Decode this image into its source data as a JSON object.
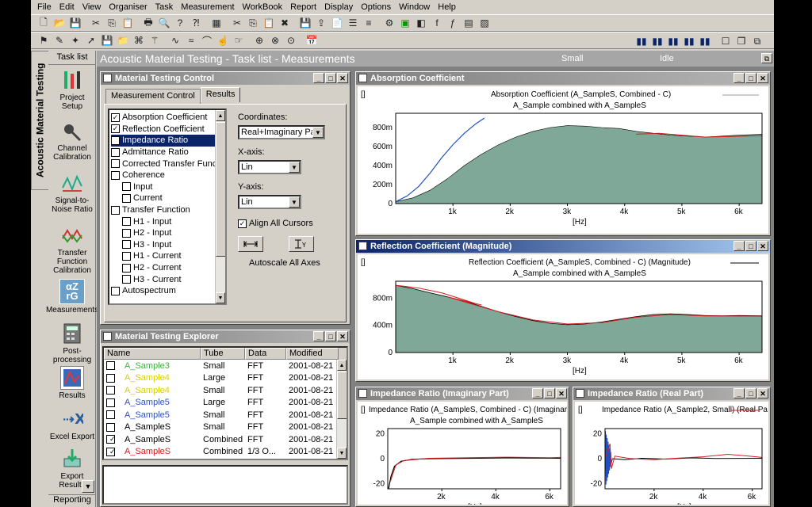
{
  "menu": [
    "File",
    "Edit",
    "View",
    "Organiser",
    "Task",
    "Measurement",
    "WorkBook",
    "Report",
    "Display",
    "Options",
    "Window",
    "Help"
  ],
  "sidebar": {
    "vertical_tab": "Acoustic Material Testing",
    "title": "Task list",
    "items": [
      {
        "label": "Project Setup"
      },
      {
        "label": "Channel Calibration"
      },
      {
        "label": "Signal-to-Noise Ratio"
      },
      {
        "label": "Transfer Function Calibration"
      },
      {
        "label": "Measurements"
      },
      {
        "label": "Post-processing"
      },
      {
        "label": "Results"
      },
      {
        "label": "Excel Export"
      },
      {
        "label": "Export Results"
      }
    ],
    "bottom": "Reporting"
  },
  "main": {
    "title": "Acoustic Material Testing - Task list - Measurements",
    "status1": "Small",
    "status2": "Idle"
  },
  "control": {
    "title": "Material Testing Control",
    "tabs": [
      "Measurement Control",
      "Results"
    ],
    "items": [
      {
        "label": "Absorption Coefficient",
        "checked": true,
        "indent": 0
      },
      {
        "label": "Reflection Coefficient",
        "checked": true,
        "indent": 0
      },
      {
        "label": "Impedance Ratio",
        "checked": true,
        "indent": 0
      },
      {
        "label": "Admittance Ratio",
        "checked": false,
        "indent": 0
      },
      {
        "label": "Corrected Transfer Function",
        "checked": false,
        "indent": 0
      },
      {
        "label": "Coherence",
        "checked": false,
        "indent": 0
      },
      {
        "label": "Input",
        "checked": false,
        "indent": 1
      },
      {
        "label": "Current",
        "checked": false,
        "indent": 1
      },
      {
        "label": "Transfer Function",
        "checked": false,
        "indent": 0
      },
      {
        "label": "H1 - Input",
        "checked": false,
        "indent": 1
      },
      {
        "label": "H2 - Input",
        "checked": false,
        "indent": 1
      },
      {
        "label": "H3 - Input",
        "checked": false,
        "indent": 1
      },
      {
        "label": "H1 - Current",
        "checked": false,
        "indent": 1
      },
      {
        "label": "H2 - Current",
        "checked": false,
        "indent": 1
      },
      {
        "label": "H3 - Current",
        "checked": false,
        "indent": 1
      },
      {
        "label": "Autospectrum",
        "checked": false,
        "indent": 0
      }
    ],
    "coordinates_label": "Coordinates:",
    "coordinates_value": "Real+Imaginary Part",
    "xaxis_label": "X-axis:",
    "xaxis_value": "Lin",
    "yaxis_label": "Y-axis:",
    "yaxis_value": "Lin",
    "align_cursors": "Align All Cursors",
    "autoscale": "Autoscale All Axes"
  },
  "explorer": {
    "title": "Material Testing Explorer",
    "columns": [
      "Name",
      "Tube",
      "Data",
      "Modified"
    ],
    "rows": [
      {
        "name": "A_Sample3",
        "tube": "Small",
        "data": "FFT",
        "modified": "2001-08-21 ...",
        "checked": false,
        "color": "#40b040"
      },
      {
        "name": "A_Sample4",
        "tube": "Large",
        "data": "FFT",
        "modified": "2001-08-21 ...",
        "checked": false,
        "color": "#d8d000"
      },
      {
        "name": "A_Sample4",
        "tube": "Small",
        "data": "FFT",
        "modified": "2001-08-21 ...",
        "checked": false,
        "color": "#d8d000"
      },
      {
        "name": "A_Sample5",
        "tube": "Large",
        "data": "FFT",
        "modified": "2001-08-21 ...",
        "checked": false,
        "color": "#3050c0"
      },
      {
        "name": "A_Sample5",
        "tube": "Small",
        "data": "FFT",
        "modified": "2001-08-21 ...",
        "checked": false,
        "color": "#3050c0"
      },
      {
        "name": "A_SampleS",
        "tube": "Small",
        "data": "FFT",
        "modified": "2001-08-21 ...",
        "checked": false,
        "color": "#000000"
      },
      {
        "name": "A_SampleS",
        "tube": "Combined",
        "data": "FFT",
        "modified": "2001-08-21 ...",
        "checked": true,
        "color": "#000000"
      },
      {
        "name": "A_SampleS",
        "tube": "Combined",
        "data": "1/3 O...",
        "modified": "2001-08-21 ...",
        "checked": true,
        "color": "#d02020"
      }
    ]
  },
  "absorption": {
    "title": "Absorption Coefficient",
    "bracket": "[]",
    "header": "Absorption Coefficient (A_SampleS, Combined - C)",
    "subheader": "A_Sample combined with A_SampleS",
    "xunit": "[Hz]",
    "xticks": [
      "1k",
      "2k",
      "3k",
      "4k",
      "5k",
      "6k"
    ],
    "yticks": [
      "0",
      "200m",
      "400m",
      "600m",
      "800m"
    ]
  },
  "reflection": {
    "title": "Reflection Coefficient (Magnitude)",
    "bracket": "[]",
    "header": "Reflection Coefficient (A_SampleS, Combined - C) (Magnitude)",
    "subheader": "A_Sample combined with A_SampleS",
    "xunit": "[Hz]",
    "xticks": [
      "1k",
      "2k",
      "3k",
      "4k",
      "5k",
      "6k"
    ],
    "yticks": [
      "0",
      "400m",
      "800m"
    ]
  },
  "imp_imag": {
    "title": "Impedance Ratio (Imaginary Part)",
    "bracket": "[]",
    "header": "Impedance Ratio (A_SampleS, Combined - C) (Imaginary",
    "subheader": "A_Sample combined with A_SampleS",
    "xunit": "[Hz]",
    "xticks": [
      "2k",
      "4k",
      "6k"
    ],
    "yticks": [
      "20",
      "0",
      "-20"
    ]
  },
  "imp_real": {
    "title": "Impedance Ratio (Real Part)",
    "bracket": "[]",
    "header": "Impedance Ratio (A_Sample2, Small) (Real Pa",
    "xunit": "[Hz]",
    "xticks": [
      "2k",
      "4k",
      "6k"
    ],
    "yticks": [
      "20",
      "0",
      "-20"
    ]
  },
  "colors": {
    "fill": "#7fa898",
    "active_title": "#0a246a"
  }
}
